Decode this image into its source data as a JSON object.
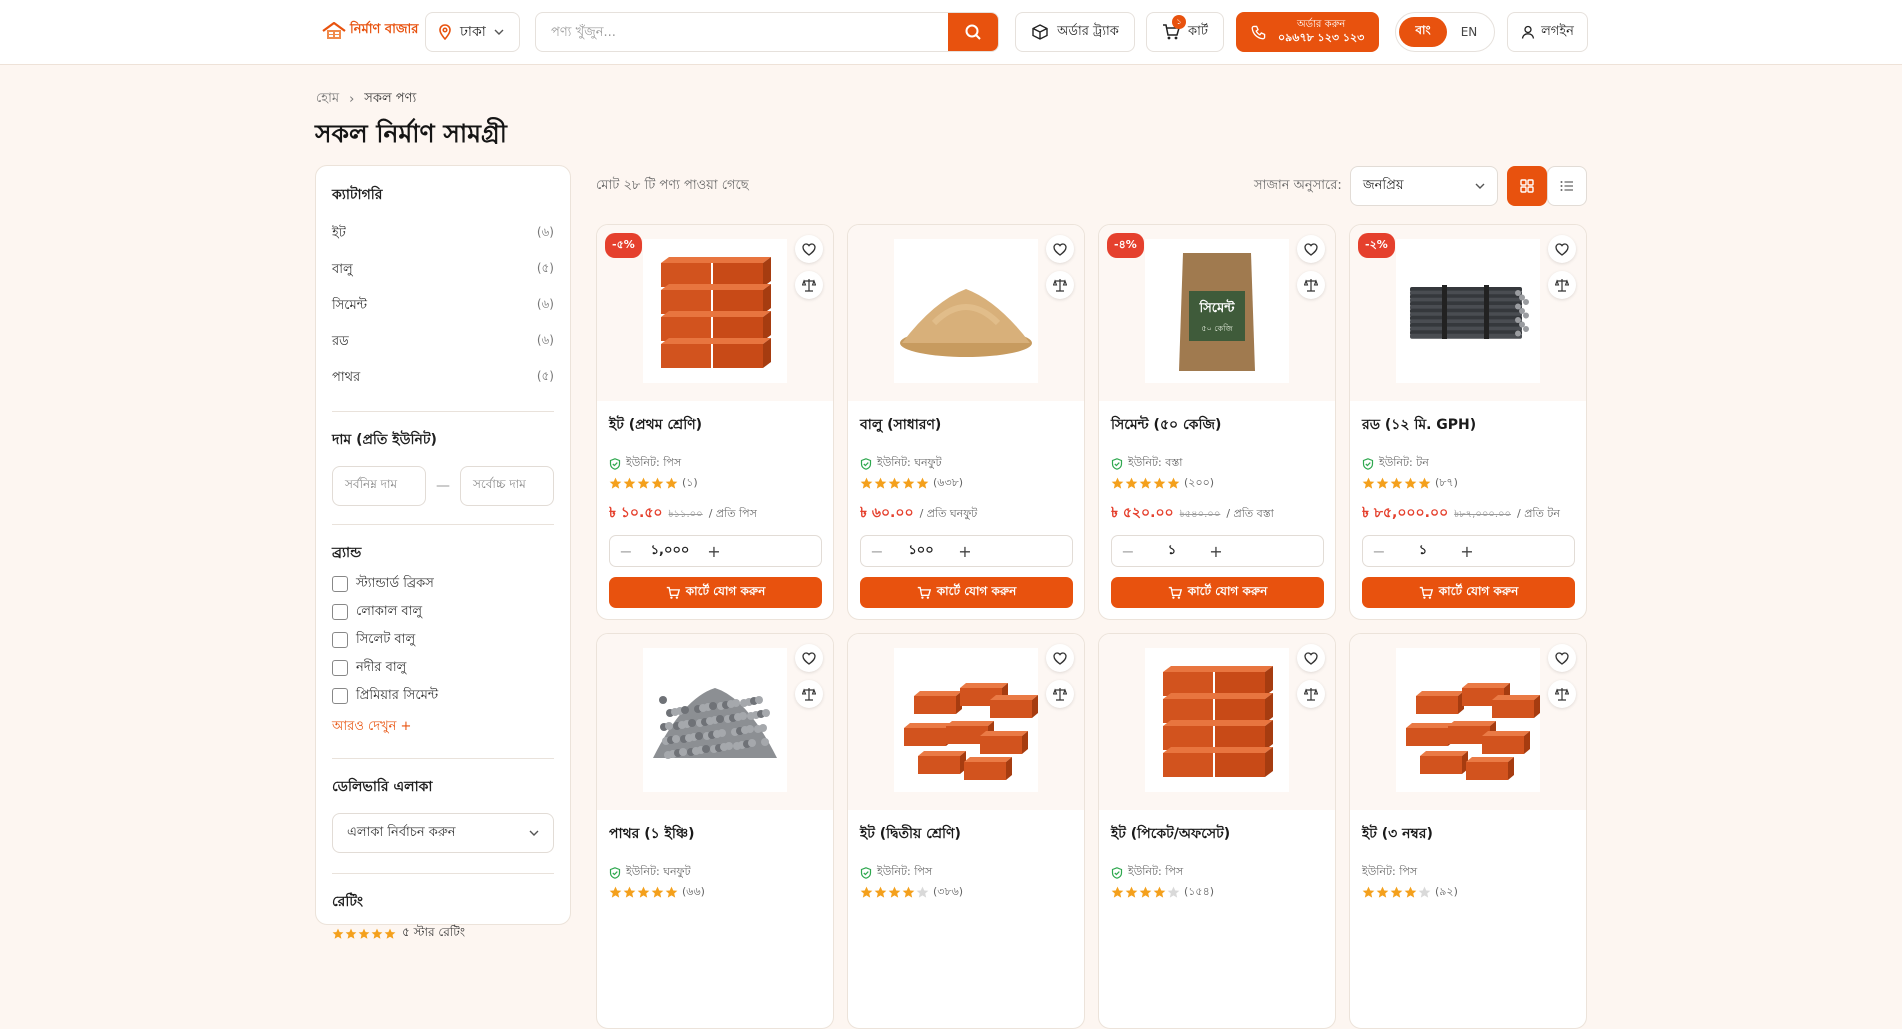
{
  "brand": {
    "name": "নির্মাণ বাজার",
    "accent": "#e8520e"
  },
  "header": {
    "location": "ঢাকা",
    "search_placeholder": "পণ্য খুঁজুন...",
    "track_label": "অর্ডার ট্র্যাক",
    "cart_label": "কার্ট",
    "cart_count": "১",
    "call_line1": "অর্ডার করুন",
    "call_line2": "০৯৬৭৮ ১২৩ ১২৩",
    "lang_active": "বাং",
    "lang_other": "EN",
    "login_label": "লগইন"
  },
  "breadcrumb": {
    "home": "হোম",
    "current": "সকল পণ্য"
  },
  "page_title": "সকল নির্মাণ সামগ্রী",
  "sidebar": {
    "categories_title": "ক্যাটাগরি",
    "categories": [
      {
        "name": "ইট",
        "count": "(৬)"
      },
      {
        "name": "বালু",
        "count": "(৫)"
      },
      {
        "name": "সিমেন্ট",
        "count": "(৬)"
      },
      {
        "name": "রড",
        "count": "(৬)"
      },
      {
        "name": "পাথর",
        "count": "(৫)"
      }
    ],
    "price_title": "দাম (প্রতি ইউনিট)",
    "price_min_placeholder": "সর্বনিম্ন দাম",
    "price_max_placeholder": "সর্বোচ্চ দাম",
    "brand_title": "ব্র্যান্ড",
    "brands": [
      "স্ট্যান্ডার্ড ব্রিকস",
      "লোকাল বালু",
      "সিলেট বালু",
      "নদীর বালু",
      "প্রিমিয়ার সিমেন্ট"
    ],
    "more_label": "আরও দেখুন +",
    "delivery_title": "ডেলিভারি এলাকা",
    "delivery_placeholder": "এলাকা নির্বাচন করুন",
    "rating_title": "রেটিং",
    "rating_option": "৫ স্টার রেটিং"
  },
  "toolbar": {
    "result_text": "মোট ২৮ টি পণ্য পাওয়া গেছে",
    "sort_label": "সাজান অনুসারে:",
    "sort_value": "জনপ্রিয়"
  },
  "add_to_cart": "কার্টে যোগ করুন",
  "products": [
    {
      "name": "ইট (প্রথম শ্রেণি)",
      "unit": "ইউনিট: পিস",
      "verified": true,
      "stars": 5,
      "reviews": "(১)",
      "price": "৳ ১০.৫০",
      "old_price": "৳১১.০০",
      "per": "/ প্রতি পিস",
      "qty": "১,০০০",
      "discount": "-৫%",
      "image": "bricks-stack"
    },
    {
      "name": "বালু (সাধারণ)",
      "unit": "ইউনিট: ঘনফুট",
      "verified": true,
      "stars": 5,
      "reviews": "(৬৩৮)",
      "price": "৳ ৬০.০০",
      "old_price": "",
      "per": "/ প্রতি ঘনফুট",
      "qty": "১০০",
      "discount": "",
      "image": "sand-pile"
    },
    {
      "name": "সিমেন্ট (৫০ কেজি)",
      "unit": "ইউনিট: বস্তা",
      "verified": true,
      "stars": 5,
      "reviews": "(২০০)",
      "price": "৳ ৫২০.০০",
      "old_price": "৳৫৪০.০০",
      "per": "/ প্রতি বস্তা",
      "qty": "১",
      "discount": "-৪%",
      "image": "cement-bag",
      "bag_text": "সিমেন্ট",
      "bag_sub": "৫০ কেজি"
    },
    {
      "name": "রড (১২ মি. GPH)",
      "unit": "ইউনিট: টন",
      "verified": true,
      "stars": 5,
      "reviews": "(৮৭)",
      "price": "৳ ৮৫,০০০.০০",
      "old_price": "৳৮৭,০০০.০০",
      "per": "/ প্রতি টন",
      "qty": "১",
      "discount": "-২%",
      "image": "rod-bundle"
    },
    {
      "name": "পাথর (১ ইঞ্চি)",
      "unit": "ইউনিট: ঘনফুট",
      "verified": true,
      "stars": 5,
      "reviews": "(৬৬)",
      "image": "stone-pile"
    },
    {
      "name": "ইট (দ্বিতীয় শ্রেণি)",
      "unit": "ইউনিট: পিস",
      "verified": true,
      "stars": 4,
      "reviews": "(৩৮৬)",
      "image": "bricks-loose"
    },
    {
      "name": "ইট (পিকেট/অফসেট)",
      "unit": "ইউনিট: পিস",
      "verified": true,
      "stars": 4,
      "reviews": "(১৫৪)",
      "image": "bricks-stack"
    },
    {
      "name": "ইট (৩ নম্বর)",
      "unit": "ইউনিট: পিস",
      "verified": false,
      "stars": 4,
      "reviews": "(৯২)",
      "image": "bricks-loose"
    }
  ]
}
